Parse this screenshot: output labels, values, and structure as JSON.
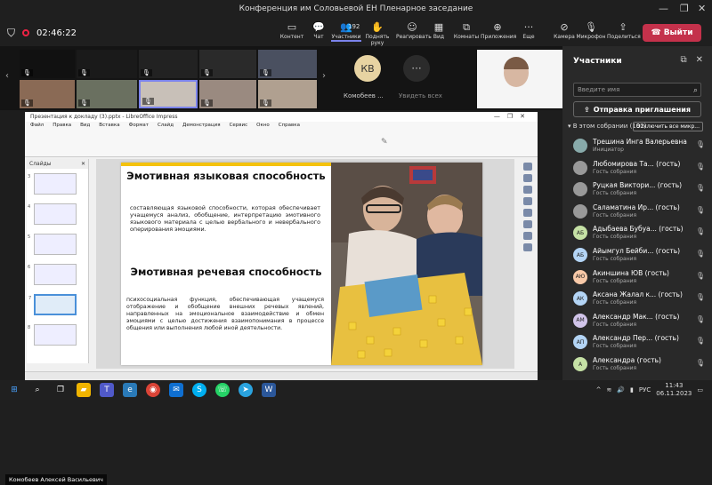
{
  "window": {
    "title": "Конференция им Соловьевой ЕН Пленарное заседание"
  },
  "meeting": {
    "timer": "02:46:22"
  },
  "toolbar": {
    "content_label": "Контент",
    "chat_label": "Чат",
    "participants_label": "Участники",
    "participants_count": "192",
    "raise_hand_label": "Поднять руку",
    "react_label": "Реагировать",
    "view_label": "Вид",
    "rooms_label": "Комнаты",
    "apps_label": "Приложения",
    "more_label": "Еще",
    "camera_label": "Камера",
    "mic_label": "Микрофон",
    "share_label": "Поделиться",
    "leave_label": "Выйти"
  },
  "strip": {
    "kb_initials": "КВ",
    "kb_name": "Комобеев ...",
    "more_label": "Увидеть всех"
  },
  "panel": {
    "title": "Участники",
    "search_placeholder": "Введите имя",
    "invite_label": "Отправка приглашения",
    "meeting_section": "В этом собрании (192)",
    "mute_all_label": "Отключить все микр...",
    "participants": [
      {
        "name": "Трешина Инга Валерьевна",
        "role": "Инициатор",
        "initials": "",
        "color": "#8aa"
      },
      {
        "name": "Любомирова Та... (гость)",
        "role": "Гость собрания",
        "initials": "",
        "color": "#999"
      },
      {
        "name": "Руцкая Виктори... (гость)",
        "role": "Гость собрания",
        "initials": "",
        "color": "#999"
      },
      {
        "name": "Саламатина Ир... (гость)",
        "role": "Гость собрания",
        "initials": "",
        "color": "#999"
      },
      {
        "name": "Адыбаева Бубуа... (гость)",
        "role": "Гость собрания",
        "initials": "АБ",
        "color": "#c5e1a5"
      },
      {
        "name": "Айымгул Бейби... (гость)",
        "role": "Гость собрания",
        "initials": "АБ",
        "color": "#b3d4f5"
      },
      {
        "name": "Акиншина ЮВ (гость)",
        "role": "Гость собрания",
        "initials": "АЮ",
        "color": "#f8c9a8"
      },
      {
        "name": "Аксана Жалал к... (гость)",
        "role": "Гость собрания",
        "initials": "АК",
        "color": "#b3d4f5"
      },
      {
        "name": "Александр Мак... (гость)",
        "role": "Гость собрания",
        "initials": "АМ",
        "color": "#d1c4e9"
      },
      {
        "name": "Александр Пер... (гость)",
        "role": "Гость собрания",
        "initials": "АП",
        "color": "#b3d4f5"
      },
      {
        "name": "Александра (гость)",
        "role": "Гость собрания",
        "initials": "А",
        "color": "#c5e1a5"
      }
    ]
  },
  "impress": {
    "title": "Презентация к докладу (3).pptx - LibreOffice Impress",
    "menu": [
      "Файл",
      "Правка",
      "Вид",
      "Вставка",
      "Формат",
      "Слайд",
      "Демонстрация",
      "Сервис",
      "Окно",
      "Справка"
    ],
    "slides_header": "Слайды",
    "slide_numbers": [
      "3",
      "4",
      "5",
      "6",
      "7",
      "8"
    ]
  },
  "slide": {
    "heading1": "Эмотивная языковая способность",
    "text1": "составляющая языковой способности, которая обеспечивает учащемуся анализ, обобщение, интерпретацию эмотивного языкового материала с целью вербального и невербального оперирования эмоциями.",
    "heading2": "Эмотивная речевая способность",
    "text2": "психосоциальная функция, обеспечивающая учащемуся отображение и обобщение внешних речевых явлений, направленных на эмоциональное взаимодействие и обмен эмоциями с целью достижения взаимопонимания в процессе общения или выполнения любой иной деятельности."
  },
  "presenter_label": "Комобеев Алексей Васильевич",
  "taskbar": {
    "lang": "РУС",
    "time": "11:43",
    "date": "06.11.2023"
  }
}
